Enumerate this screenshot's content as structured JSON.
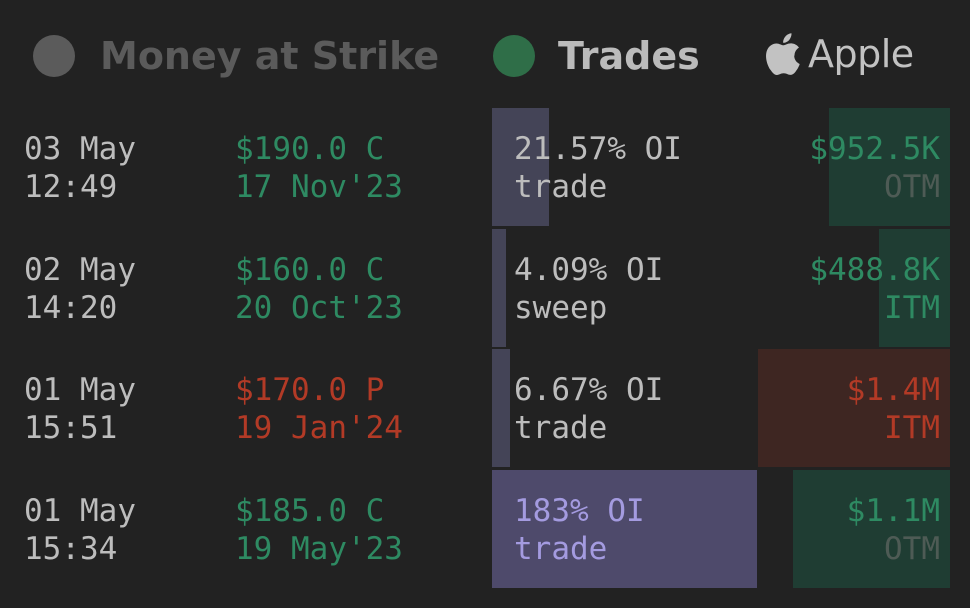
{
  "header": {
    "tabs": [
      {
        "label": "Money at Strike",
        "active": false,
        "dot_color": "#5b5b5b"
      },
      {
        "label": "Trades",
        "active": true,
        "dot_color": "#2f6e48"
      }
    ],
    "brand": {
      "name": "Apple",
      "icon": "apple-logo-icon"
    }
  },
  "colors": {
    "background": "#222222",
    "call": "#2e8a62",
    "put": "#b23a26",
    "oi_bar": "#444457",
    "oi_bar_high": "#4e4a6b",
    "call_premium_bar": "#1f3d33",
    "put_premium_bar": "#3e2622"
  },
  "trades": [
    {
      "date": "03 May",
      "time": "12:49",
      "strike": "$190.0 C",
      "expiry": "17 Nov'23",
      "side": "call",
      "oi_pct_text": "21.57% OI",
      "type": "trade",
      "oi_fraction": 0.2157,
      "premium": "$952.5K",
      "moneyness": "OTM",
      "premium_fraction": 0.63
    },
    {
      "date": "02 May",
      "time": "14:20",
      "strike": "$160.0 C",
      "expiry": "20 Oct'23",
      "side": "call",
      "oi_pct_text": "4.09% OI",
      "type": "sweep",
      "oi_fraction": 0.0409,
      "premium": "$488.8K",
      "moneyness": "ITM",
      "premium_fraction": 0.37
    },
    {
      "date": "01 May",
      "time": "15:51",
      "strike": "$170.0 P",
      "expiry": "19 Jan'24",
      "side": "put",
      "oi_pct_text": "6.67% OI",
      "type": "trade",
      "oi_fraction": 0.0667,
      "premium": "$1.4M",
      "moneyness": "ITM",
      "premium_fraction": 1.0
    },
    {
      "date": "01 May",
      "time": "15:34",
      "strike": "$185.0 C",
      "expiry": "19 May'23",
      "side": "call",
      "oi_pct_text": "183% OI",
      "type": "trade",
      "oi_fraction": 1.83,
      "premium": "$1.1M",
      "moneyness": "OTM",
      "premium_fraction": 0.82
    }
  ]
}
